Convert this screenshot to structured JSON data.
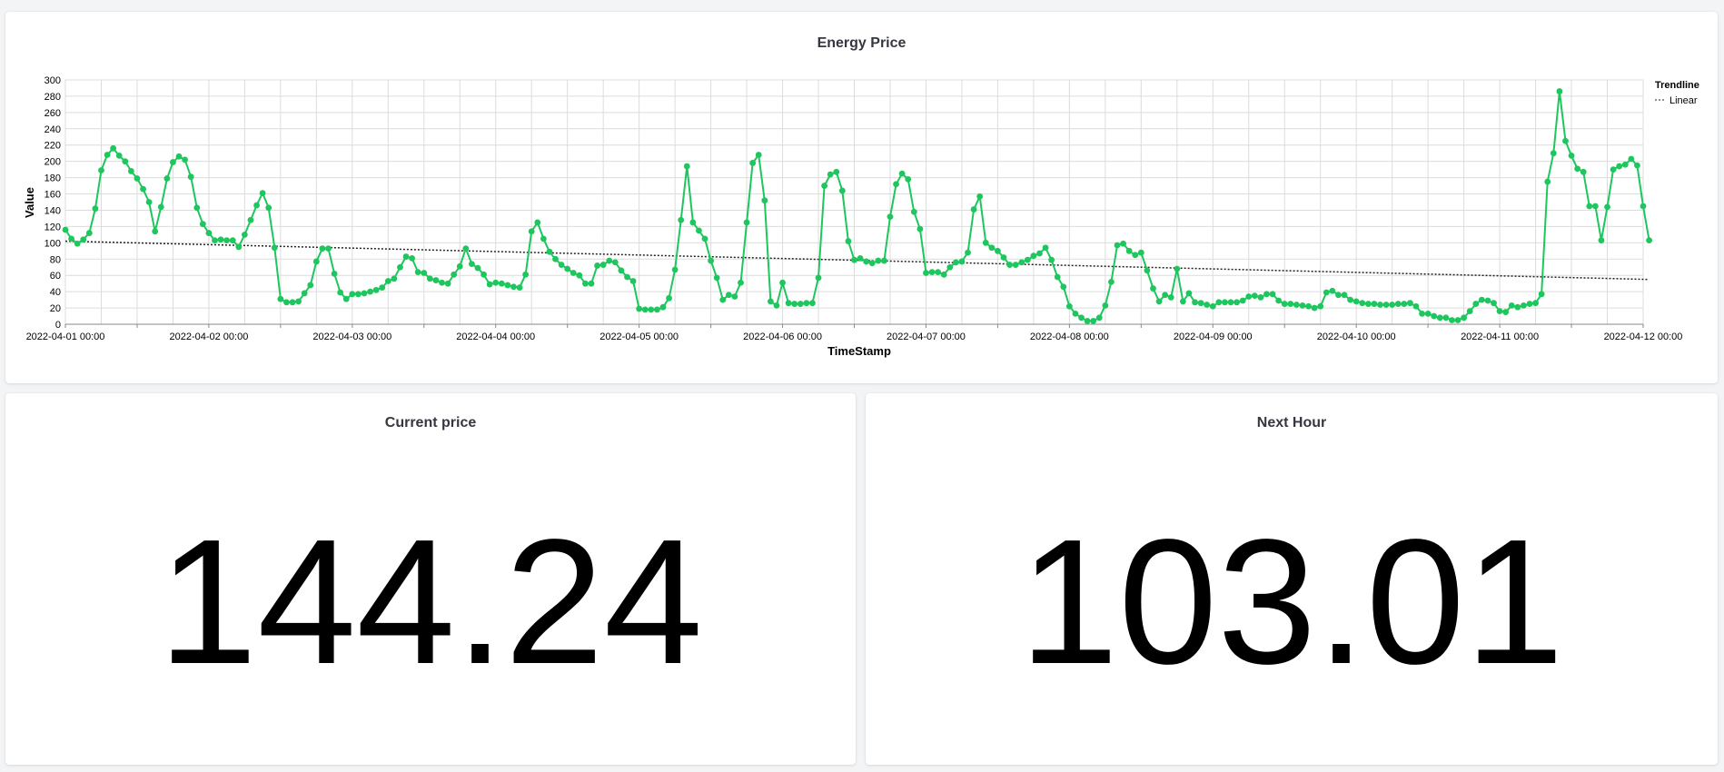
{
  "panels": {
    "chart": {
      "title": "Energy Price"
    },
    "current": {
      "title": "Current price",
      "value": "144.24"
    },
    "next": {
      "title": "Next Hour",
      "value": "103.01"
    }
  },
  "colors": {
    "series": "#1ec65e",
    "trendline": "#222222",
    "grid": "#dcdcdc"
  },
  "chart_data": {
    "type": "line",
    "title": "Energy Price",
    "xlabel": "TimeStamp",
    "ylabel": "Value",
    "ylim": [
      0,
      300
    ],
    "yticks": [
      0,
      20,
      40,
      60,
      80,
      100,
      120,
      140,
      160,
      180,
      200,
      220,
      240,
      260,
      280,
      300
    ],
    "xticks": [
      "2022-04-01 00:00",
      "2022-04-02 00:00",
      "2022-04-03 00:00",
      "2022-04-04 00:00",
      "2022-04-05 00:00",
      "2022-04-06 00:00",
      "2022-04-07 00:00",
      "2022-04-08 00:00",
      "2022-04-09 00:00",
      "2022-04-10 00:00",
      "2022-04-11 00:00",
      "2022-04-12 00:00"
    ],
    "x_range": [
      "2022-04-01 00:00",
      "2022-04-12 00:00"
    ],
    "grid": true,
    "legend": {
      "title": "Trendline",
      "position": "top-right",
      "entries": [
        "Linear"
      ]
    },
    "trendline": {
      "type": "linear",
      "start": 102,
      "end": 55
    },
    "series": [
      {
        "interval": "1h",
        "start": "2022-04-01 00:00",
        "values": [
          116,
          105,
          99,
          104,
          112,
          142,
          189,
          208,
          216,
          207,
          200,
          188,
          179,
          166,
          150,
          114,
          144,
          179,
          199,
          206,
          202,
          181,
          143,
          123,
          112,
          103,
          104,
          103,
          103,
          95,
          110,
          128,
          146,
          161,
          143,
          94,
          31,
          27,
          27,
          28,
          38,
          48,
          77,
          93,
          93,
          62,
          39,
          31,
          37,
          37,
          38,
          40,
          42,
          45,
          53,
          56,
          70,
          83,
          81,
          64,
          63,
          56,
          54,
          51,
          50,
          61,
          71,
          93,
          74,
          69,
          61,
          49,
          51,
          50,
          48,
          46,
          45,
          61,
          114,
          125,
          105,
          89,
          80,
          73,
          68,
          63,
          60,
          50,
          50,
          72,
          73,
          78,
          76,
          66,
          58,
          53,
          19,
          18,
          18,
          18,
          21,
          32,
          67,
          128,
          194,
          125,
          115,
          105,
          78,
          57,
          30,
          36,
          34,
          51,
          125,
          198,
          208,
          152,
          28,
          23,
          51,
          26,
          25,
          25,
          26,
          26,
          57,
          170,
          184,
          187,
          164,
          102,
          79,
          81,
          77,
          75,
          78,
          78,
          132,
          172,
          185,
          178,
          138,
          117,
          63,
          64,
          64,
          61,
          70,
          76,
          77,
          88,
          141,
          157,
          100,
          94,
          90,
          82,
          73,
          73,
          76,
          79,
          84,
          87,
          94,
          79,
          58,
          46,
          22,
          13,
          8,
          4,
          4,
          8,
          23,
          52,
          97,
          99,
          90,
          85,
          88,
          66,
          44,
          28,
          36,
          33,
          68,
          28,
          38,
          27,
          26,
          24,
          22,
          27,
          27,
          27,
          27,
          29,
          34,
          35,
          33,
          37,
          37,
          29,
          25,
          25,
          24,
          23,
          22,
          20,
          22,
          39,
          41,
          36,
          36,
          30,
          28,
          26,
          25,
          25,
          24,
          24,
          24,
          25,
          25,
          26,
          22,
          13,
          13,
          10,
          8,
          8,
          5,
          5,
          8,
          16,
          25,
          30,
          29,
          26,
          16,
          15,
          23,
          21,
          23,
          25,
          26,
          37,
          175,
          210,
          286,
          225,
          207,
          191,
          187,
          145,
          145,
          103,
          144,
          190,
          194,
          196,
          203,
          195,
          145,
          103
        ]
      }
    ]
  }
}
